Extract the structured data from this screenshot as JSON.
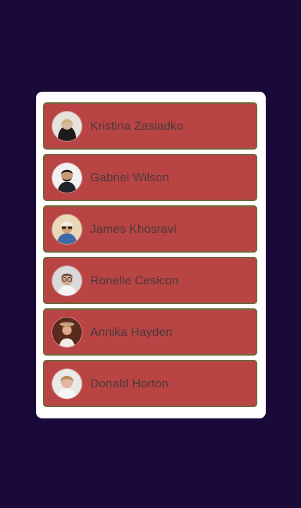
{
  "page": {
    "background_color": "#1a0a3a",
    "card_color": "#ffffff",
    "item_color": "#b94444",
    "item_border_color": "#6f6a3a"
  },
  "contacts": [
    {
      "name": "Kristina Zasiadko",
      "avatar": "avatar-photo"
    },
    {
      "name": "Gabriel Wilson",
      "avatar": "avatar-photo"
    },
    {
      "name": "James Khosravi",
      "avatar": "avatar-photo"
    },
    {
      "name": "Ronelle Cesicon",
      "avatar": "avatar-photo"
    },
    {
      "name": "Annika Hayden",
      "avatar": "avatar-photo"
    },
    {
      "name": "Donald Horton",
      "avatar": "avatar-photo"
    }
  ]
}
